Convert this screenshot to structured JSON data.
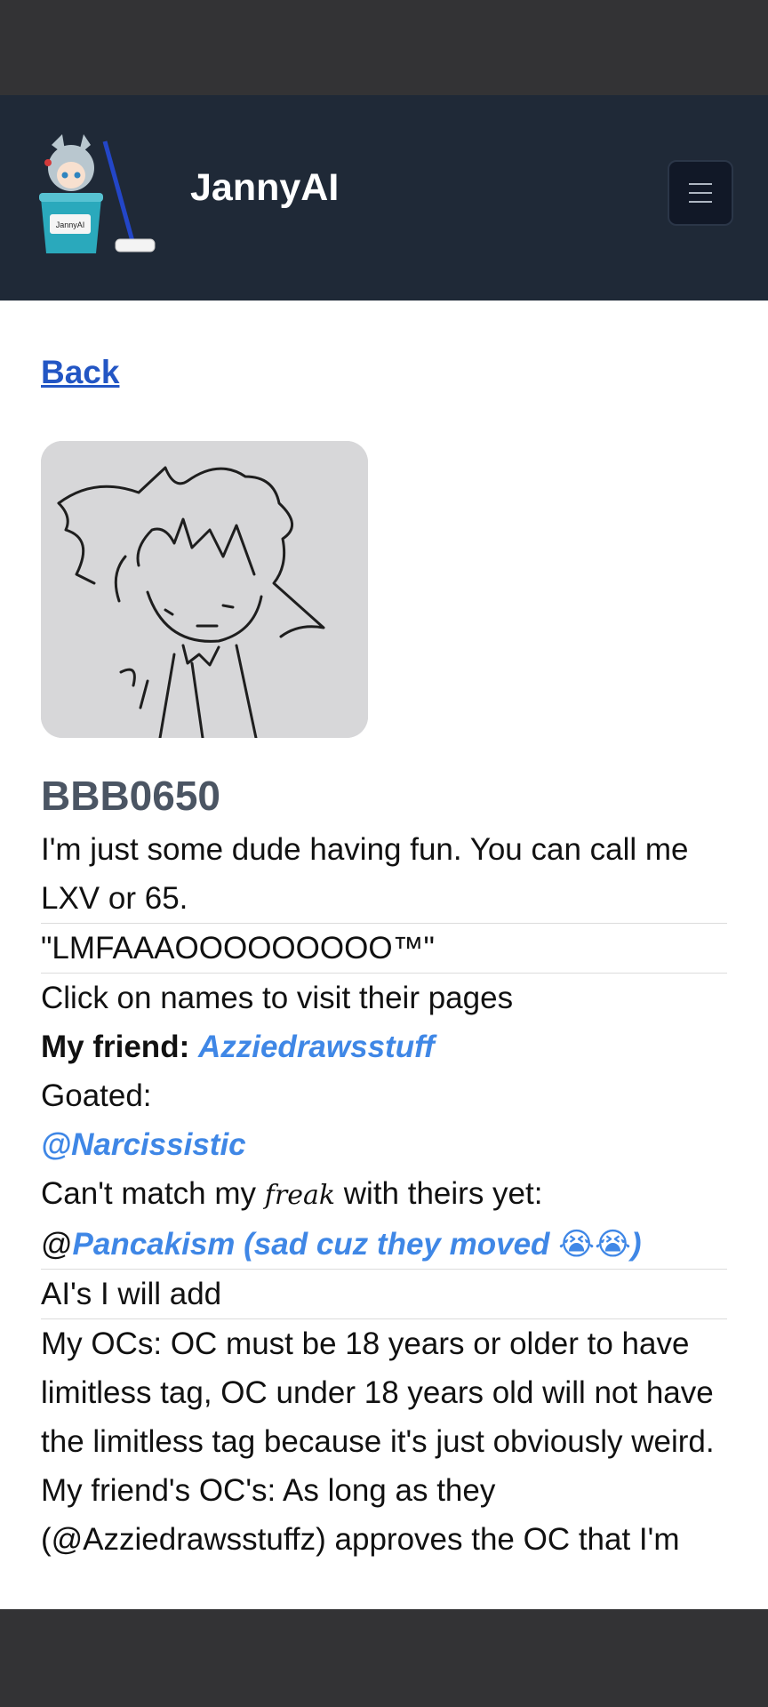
{
  "nav": {
    "brand": "JannyAI",
    "logo_text": "JannyAI",
    "menu_icon": "hamburger-icon"
  },
  "back_label": "Back",
  "profile": {
    "username": "BBB0650",
    "intro": "I'm just some dude having fun. You can call me LXV or 65.",
    "quote": "\"LMFAAAOOOOOOOOO™\"",
    "click_hint": "Click on names to visit their pages",
    "friend_label": "My friend:",
    "friend_name": "Azziedrawsstuff",
    "goated_label": "Goated:",
    "goated_name": "@Narcissistic",
    "freak_prefix": "Can't match my",
    "freak_word": "freak",
    "freak_suffix": "with theirs yet:",
    "at_sign": "@",
    "pancakism": "Pancakism (sad cuz they moved 😭😭)",
    "ais_heading": "AI's I will add",
    "ocs_text": "My OCs: OC must be 18 years or older to have limitless tag, OC under 18 years old will not have the limitless tag because it's just obviously weird.",
    "friends_ocs_text": "My friend's OC's: As long as they (@Azziedrawsstuffz) approves the OC that I'm"
  }
}
